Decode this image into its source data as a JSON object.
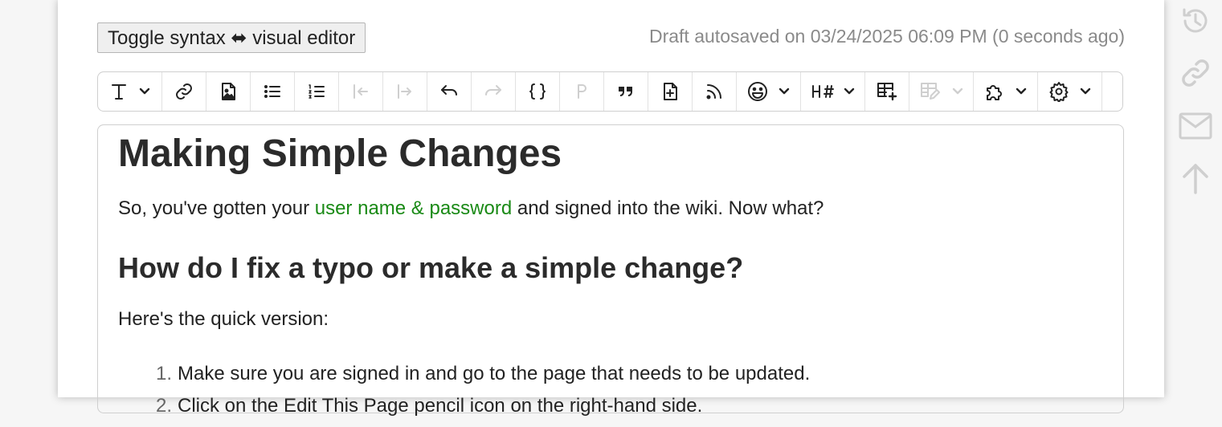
{
  "toggle_button": {
    "label": "Toggle syntax ⬌ visual editor"
  },
  "autosave": {
    "text": "Draft autosaved on 03/24/2025 06:09 PM (0 seconds ago)"
  },
  "toolbar": {
    "items": [
      {
        "icon": "text-format-icon",
        "dropdown": true
      },
      {
        "icon": "link-icon"
      },
      {
        "icon": "image-icon"
      },
      {
        "icon": "bulleted-list-icon"
      },
      {
        "icon": "numbered-list-icon"
      },
      {
        "icon": "outdent-icon",
        "disabled": true
      },
      {
        "icon": "indent-icon",
        "disabled": true
      },
      {
        "icon": "undo-icon"
      },
      {
        "icon": "redo-icon",
        "disabled": true
      },
      {
        "icon": "code-braces-icon"
      },
      {
        "icon": "paragraph-icon",
        "disabled": true
      },
      {
        "icon": "blockquote-icon"
      },
      {
        "icon": "insert-page-icon"
      },
      {
        "icon": "rss-feed-icon"
      },
      {
        "icon": "emoji-icon",
        "dropdown": true
      },
      {
        "icon": "heading-number-icon",
        "dropdown": true
      },
      {
        "icon": "table-insert-icon"
      },
      {
        "icon": "table-edit-icon",
        "dropdown": true,
        "disabled": true
      },
      {
        "icon": "plugin-puzzle-icon",
        "dropdown": true
      },
      {
        "icon": "settings-gear-icon",
        "dropdown": true
      }
    ]
  },
  "content": {
    "title": "Making Simple Changes",
    "intro_before": "So, you've gotten your ",
    "intro_link": "user name & password",
    "intro_after": " and signed into the wiki. Now what?",
    "subheading": "How do I fix a typo or make a simple change?",
    "quick_version": "Here's the quick version:",
    "steps": [
      {
        "num": "1.",
        "text": "Make sure you are signed in and go to the page that needs to be updated."
      },
      {
        "num": "2.",
        "text": "Click on the Edit This Page pencil icon on the right-hand side."
      }
    ]
  },
  "side_icons": [
    "history-icon",
    "permalink-icon",
    "email-icon",
    "arrow-up-icon"
  ]
}
